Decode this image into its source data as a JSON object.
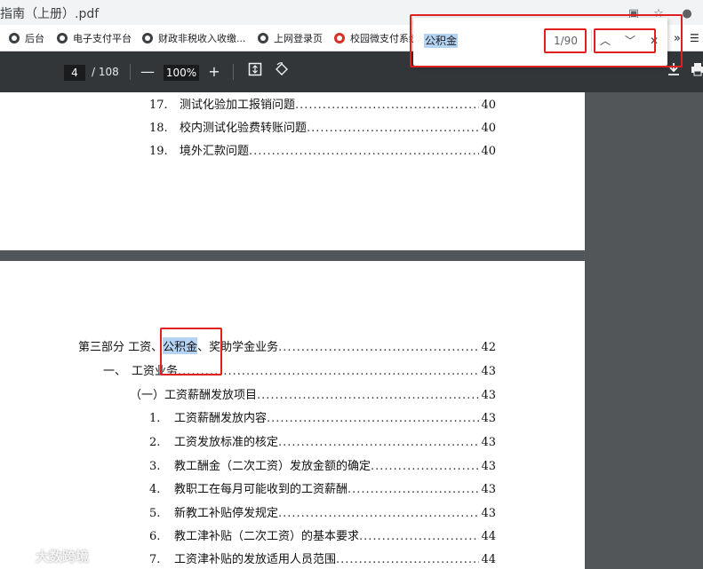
{
  "browser": {
    "tab_title": "指南（上册）.pdf",
    "bookmarks": [
      {
        "label": "后台",
        "icon": "globe-icon"
      },
      {
        "label": "电子支付平台",
        "icon": "globe-icon"
      },
      {
        "label": "财政非税收入收缴...",
        "icon": "globe-icon"
      },
      {
        "label": "上网登录页",
        "icon": "globe-icon"
      },
      {
        "label": "校园微支付系统",
        "icon": "school-logo-icon"
      }
    ],
    "overflow_label": "»"
  },
  "pdf_toolbar": {
    "current_page": "4",
    "total_pages": "/ 108",
    "zoom_out": "—",
    "zoom_level": "100%",
    "zoom_in": "+"
  },
  "find_bar": {
    "query": "公积金",
    "count": "1/90",
    "prev_glyph": "︿",
    "next_glyph": "﹀",
    "close_glyph": "✕"
  },
  "page_top": {
    "entries": [
      {
        "num": "17.",
        "text": "测试化验加工报销问题",
        "page": "40"
      },
      {
        "num": "18.",
        "text": "校内测试化验费转账问题",
        "page": "40"
      },
      {
        "num": "19.",
        "text": "境外汇款问题",
        "page": "40"
      }
    ]
  },
  "page_bottom": {
    "part": {
      "prefix": "第三部分  工资、",
      "highlight": "公积金",
      "suffix": "、奖助学金业务",
      "page": "42"
    },
    "section": {
      "num": "一、",
      "text": "工资业务",
      "page": "43"
    },
    "subsection": {
      "text": "（一）工资薪酬发放项目",
      "page": "43"
    },
    "entries": [
      {
        "num": "1.",
        "text": "工资薪酬发放内容",
        "page": "43"
      },
      {
        "num": "2.",
        "text": "工资发放标准的核定",
        "page": "43"
      },
      {
        "num": "3.",
        "text": "教工酬金（二次工资）发放金额的确定",
        "page": "43"
      },
      {
        "num": "4.",
        "text": "教职工在每月可能收到的工资薪酬",
        "page": "43"
      },
      {
        "num": "5.",
        "text": "新教工补贴停发规定",
        "page": "43"
      },
      {
        "num": "6.",
        "text": "教工津补贴（二次工资）的基本要求",
        "page": "44"
      },
      {
        "num": "7.",
        "text": "工资津补贴的发放适用人员范围",
        "page": "44"
      }
    ]
  },
  "watermark": {
    "text": "大数跨境"
  }
}
